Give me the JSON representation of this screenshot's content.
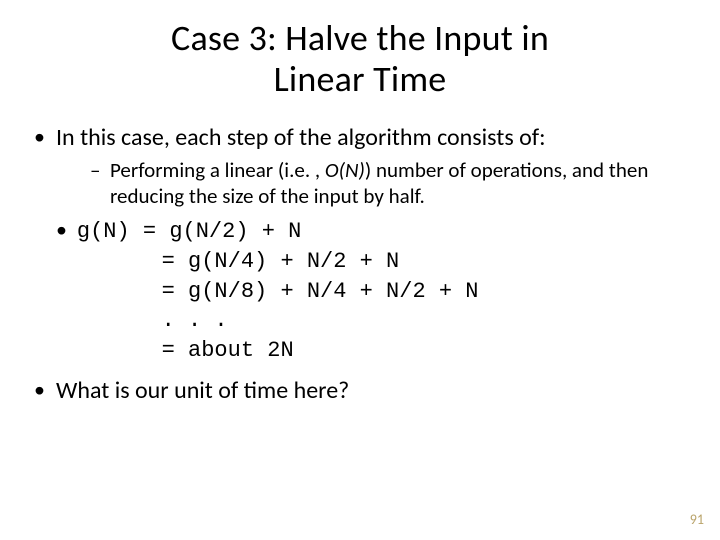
{
  "title_line1": "Case 3: Halve the Input in",
  "title_line2": "Linear Time",
  "bullet1": "In this case, each step of the algorithm consists of:",
  "sub1_prefix": "Performing a linear (i.e. , ",
  "sub1_on": "O(N)",
  "sub1_suffix": ") number of operations, and then reducing the size of the input by half.",
  "eq_line1": "g(N) = g(N/2) + N",
  "eq_line2": "     = g(N/4) + N/2 + N",
  "eq_line3": "     = g(N/8) + N/4 + N/2 + N",
  "eq_line4": "     . . .",
  "eq_line5": "     = about 2N",
  "bullet2": "What is our unit of time here?",
  "page_number": "91"
}
